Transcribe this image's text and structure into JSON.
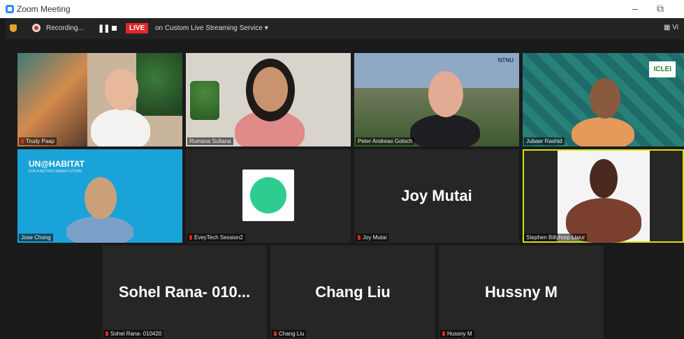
{
  "window": {
    "title": "Zoom Meeting",
    "minimize": "–",
    "restore": "⧉"
  },
  "toolbar": {
    "recording_label": "Recording...",
    "live_label": "LIVE",
    "stream_label": "on Custom Live Streaming Service",
    "stream_caret": "▾",
    "view_label": "Vi"
  },
  "participants": [
    {
      "name": "Trudy Paap",
      "muted": true
    },
    {
      "name": "Rumana Sultana",
      "muted": false
    },
    {
      "name": "Peter Andreas Gotsch",
      "muted": false,
      "logo_text": "NTNU"
    },
    {
      "name": "Jubaer Rashid",
      "muted": false,
      "logo_text": "ICLEI"
    },
    {
      "name": "Jose Chong",
      "muted": false,
      "banner_text": "UN@HABITAT",
      "banner_sub": "FOR A BETTER URBAN FUTURE"
    },
    {
      "name": "EveyTech Session2",
      "muted": true
    },
    {
      "name": "Joy Mutai",
      "display": "Joy Mutai",
      "muted": true
    },
    {
      "name": "Stephen Billyhorp Liwur",
      "muted": false,
      "active_speaker": true
    },
    {
      "name": "Sohel Rana- 010420",
      "display": "Sohel Rana- 010...",
      "muted": true
    },
    {
      "name": "Chang Liu",
      "display": "Chang Liu",
      "muted": true
    },
    {
      "name": "Hussny M",
      "display": "Hussny M",
      "muted": true
    }
  ],
  "colors": {
    "active_speaker": "#d7e400",
    "live": "#e02828",
    "muted": "#e02828",
    "everytech_logo": "#2ecc8f"
  }
}
